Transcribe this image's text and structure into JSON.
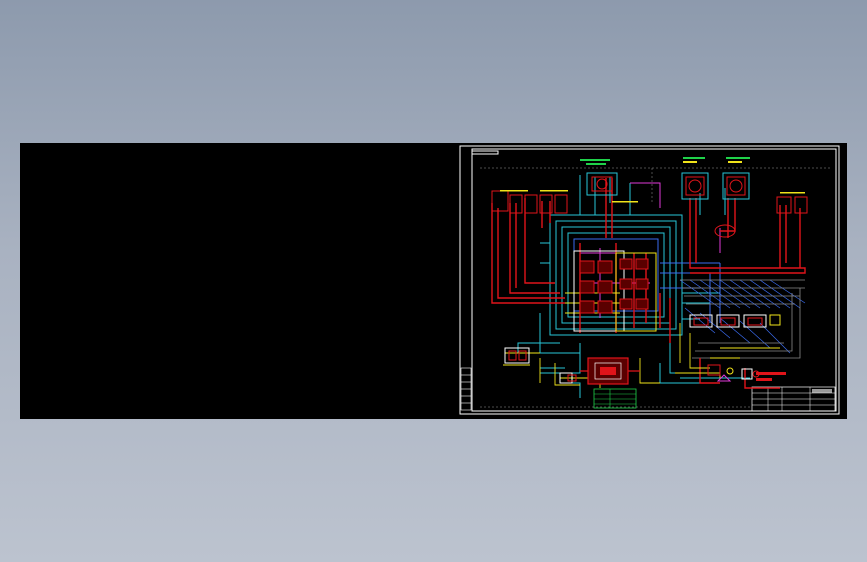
{
  "viewer": {
    "background_top": "#8d9aad",
    "background_bottom": "#bcc3cf",
    "canvas_color": "#000000"
  },
  "drawing": {
    "frame_color": "#ffffff",
    "colors": {
      "red": "#e0141a",
      "cyan": "#27c6d8",
      "yellow": "#f0e31a",
      "green": "#1fd24a",
      "white": "#ffffff",
      "blue": "#3a6cf0",
      "magenta": "#e03ad8"
    },
    "title_block": {
      "red_text_lines": 2,
      "legend_rows": 4
    },
    "note": ""
  }
}
